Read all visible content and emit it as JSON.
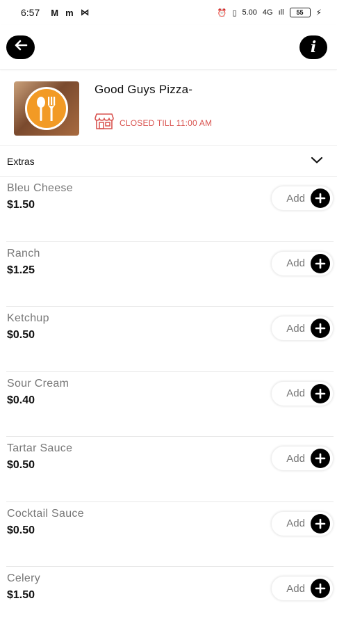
{
  "status_bar": {
    "time": "6:57",
    "left_icons": [
      "M",
      "m",
      "⋈"
    ],
    "right_icons": [
      "⏰",
      "▯",
      "5.00",
      "4G",
      "ıll",
      "55",
      "⚡"
    ]
  },
  "app_bar": {
    "back_icon": "back-arrow-icon",
    "info_icon": "info-icon",
    "info_glyph": "i"
  },
  "store": {
    "name": "Good Guys Pizza-",
    "status_text": "CLOSED TILL 11:00 AM",
    "status_color": "#d9534f",
    "logo_color": "#f29a25"
  },
  "section": {
    "title": "Extras"
  },
  "items": [
    {
      "name": "Bleu Cheese",
      "price": "$1.50",
      "add_label": "Add"
    },
    {
      "name": "Ranch",
      "price": "$1.25",
      "add_label": "Add"
    },
    {
      "name": "Ketchup",
      "price": "$0.50",
      "add_label": "Add"
    },
    {
      "name": "Sour Cream",
      "price": "$0.40",
      "add_label": "Add"
    },
    {
      "name": "Tartar Sauce",
      "price": "$0.50",
      "add_label": "Add"
    },
    {
      "name": "Cocktail Sauce",
      "price": "$0.50",
      "add_label": "Add"
    },
    {
      "name": "Celery",
      "price": "$1.50",
      "add_label": "Add"
    }
  ]
}
